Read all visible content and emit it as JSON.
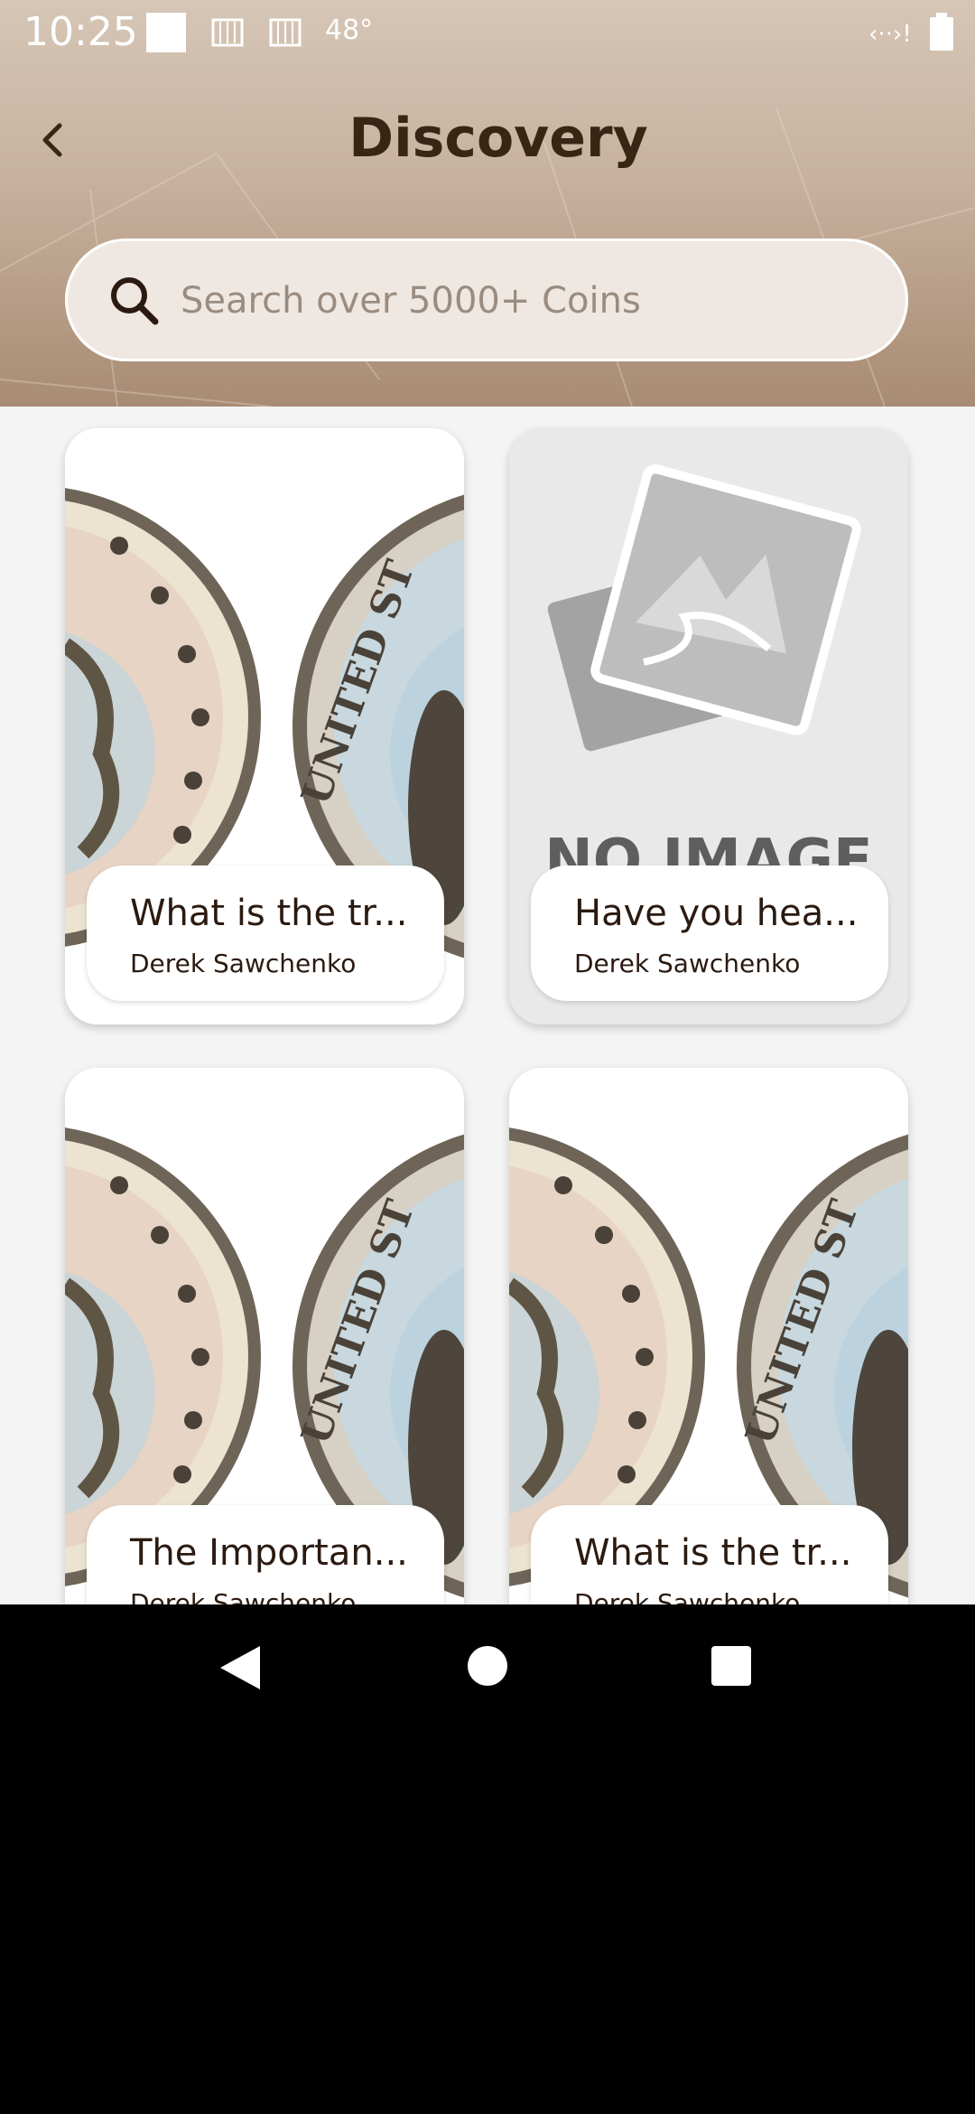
{
  "status": {
    "time": "10:25",
    "temperature": "48°"
  },
  "header": {
    "title": "Discovery"
  },
  "search": {
    "placeholder": "Search over 5000+ Coins"
  },
  "cards": [
    {
      "title": "What is the tr...",
      "author": "Derek Sawchenko",
      "image": "coin"
    },
    {
      "title": "Have you hea...",
      "author": "Derek Sawchenko",
      "image": "no-image",
      "image_text": "NO IMAGE"
    },
    {
      "title": "The Importan...",
      "author": "Derek Sawchenko",
      "image": "coin"
    },
    {
      "title": "What is the tr...",
      "author": "Derek Sawchenko",
      "image": "coin"
    }
  ],
  "navbar": {
    "icons": [
      "back-icon",
      "home-icon",
      "recents-icon"
    ]
  }
}
